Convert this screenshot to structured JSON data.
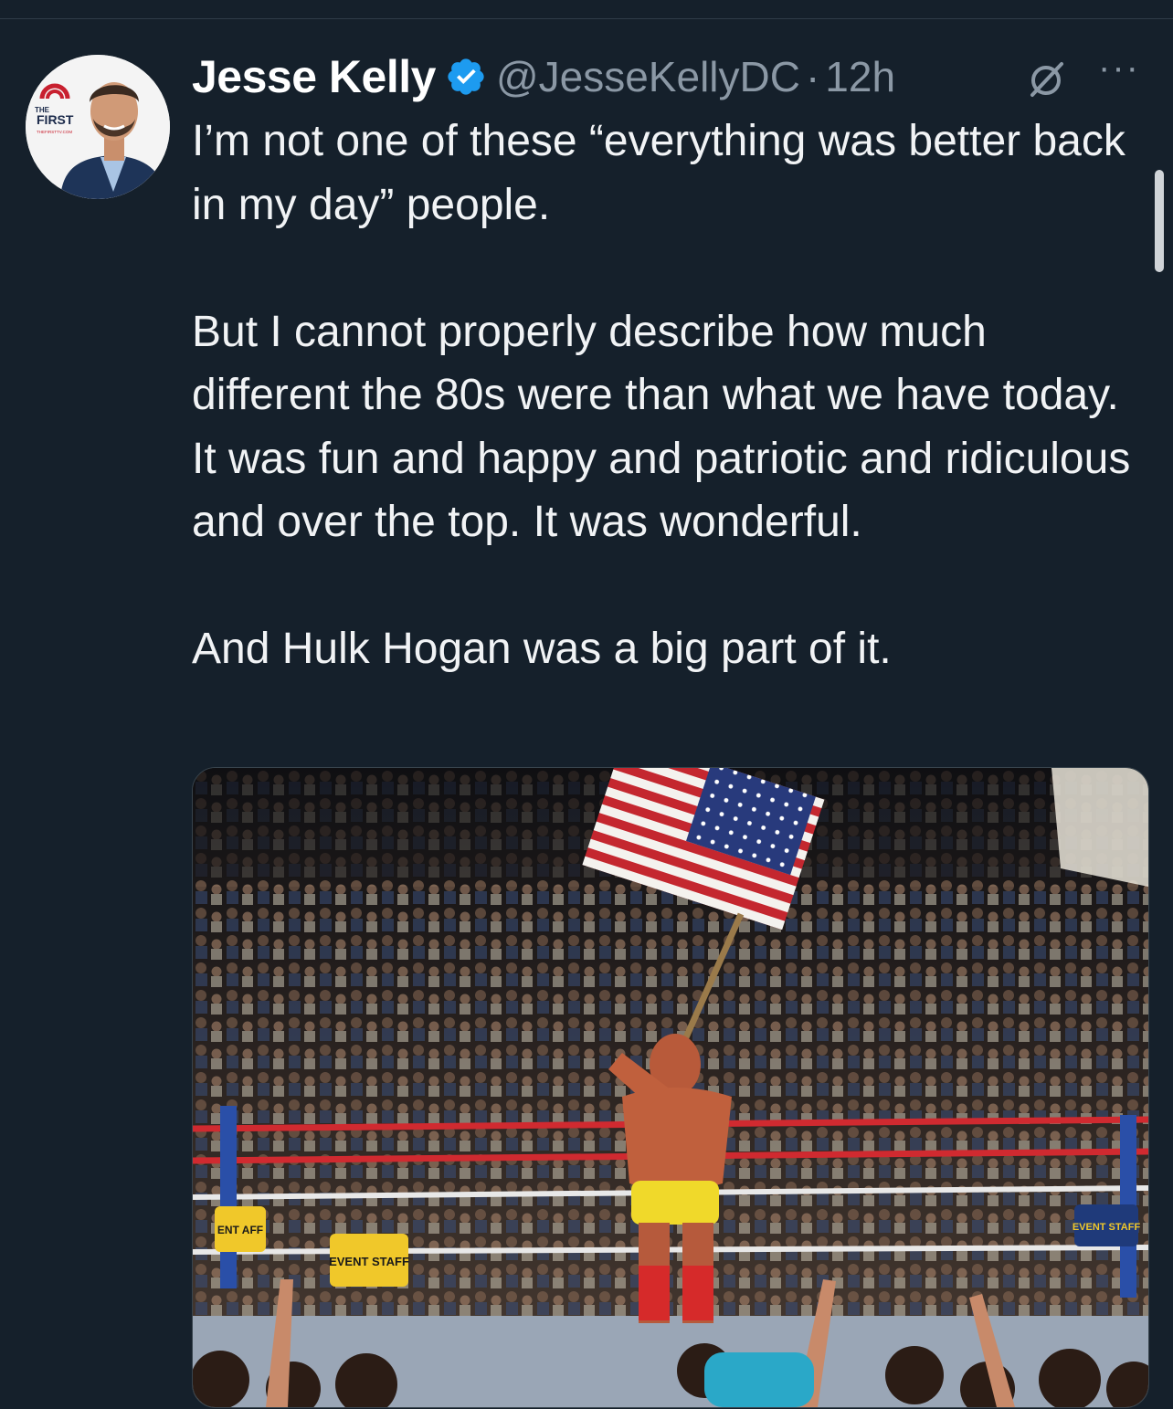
{
  "tweet": {
    "author_name": "Jesse Kelly",
    "handle": "@JesseKellyDC",
    "separator": "·",
    "time": "12h",
    "more_label": "···",
    "verified_color": "#1d9bf0",
    "paragraphs": [
      "I’m not one of these “everything was better back in my day” people.",
      "But I cannot properly describe how much different the 80s were than what we have today. It was fun and happy and patriotic and ridiculous and over the top. It was wonderful.",
      "And Hulk Hogan was a big part of it."
    ]
  },
  "avatar": {
    "logo_the": "THE",
    "logo_first": "FIRST",
    "logo_url": "THEFIRSTTV.COM"
  },
  "photo": {
    "sign_left": "EVENT STAFF",
    "sign_left_partial": "ENT AFF",
    "sign_right": "EVENT STAFF"
  },
  "colors": {
    "background": "#15202b",
    "text": "#f1f3f5",
    "secondary": "#8b98a5"
  }
}
